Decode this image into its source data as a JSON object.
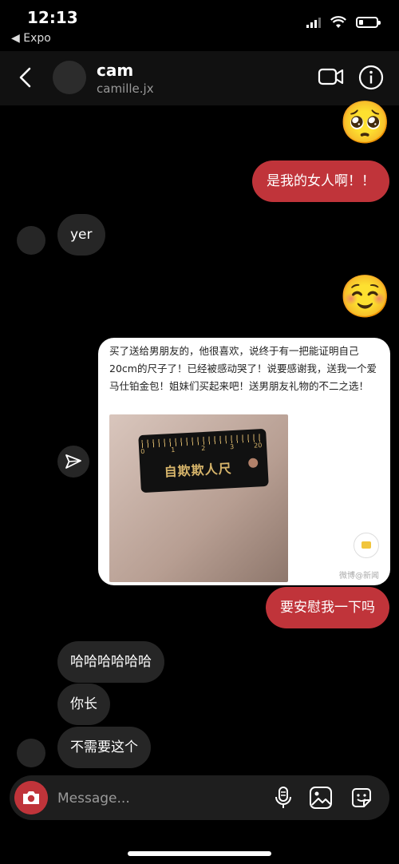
{
  "status_bar": {
    "time": "12:13",
    "back_app": "◀ Expo"
  },
  "header": {
    "name": "cam",
    "username": "camille.jx"
  },
  "messages": {
    "m1_emoji": "🥺",
    "m2_text": "是我的女人啊！！",
    "m3_text": "yer",
    "m4_emoji": "☺️",
    "shared_post": {
      "caption": "买了送给男朋友的，他很喜欢，说终于有一把能证明自己20cm的尺子了！已经被感动哭了！说要感谢我，送我一个爱马仕铂金包！姐妹们买起来吧！送男朋友礼物的不二之选！",
      "ruler_label": "自欺欺人尺",
      "ruler_numbers": [
        "0",
        "1",
        "2",
        "3",
        "20"
      ],
      "watermark": "微博@新闻"
    },
    "m6_text": "要安慰我一下吗",
    "m7_text": "哈哈哈哈哈哈",
    "m8_text": "你长",
    "m9_text": "不需要这个"
  },
  "composer": {
    "placeholder": "Message..."
  },
  "colors": {
    "accent": "#c0343a",
    "incoming_bubble": "#262626",
    "background": "#000000"
  },
  "icons": [
    "back-arrow-icon",
    "video-call-icon",
    "info-icon",
    "share-icon",
    "camera-icon",
    "microphone-icon",
    "gallery-icon",
    "sticker-icon"
  ]
}
